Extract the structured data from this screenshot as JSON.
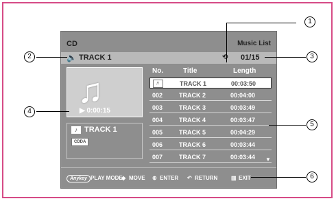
{
  "header": {
    "source": "CD",
    "view": "Music List"
  },
  "status_bar": {
    "speaker_icon": "speaker-icon",
    "track": "TRACK 1",
    "repeat_icon": "repeat-icon",
    "counter": "01/15"
  },
  "art": {
    "time": "▶ 0:00:15"
  },
  "track_panel": {
    "name": "TRACK 1",
    "format": "CDDA"
  },
  "table": {
    "headers": {
      "no": "No.",
      "title": "Title",
      "length": "Length"
    },
    "rows": [
      {
        "no": "♬",
        "title": "TRACK 1",
        "length": "00:03:50",
        "selected": true
      },
      {
        "no": "002",
        "title": "TRACK 2",
        "length": "00:04:00"
      },
      {
        "no": "003",
        "title": "TRACK 3",
        "length": "00:03:49"
      },
      {
        "no": "004",
        "title": "TRACK 4",
        "length": "00:03:47"
      },
      {
        "no": "005",
        "title": "TRACK 5",
        "length": "00:04:29"
      },
      {
        "no": "006",
        "title": "TRACK 6",
        "length": "00:03:44"
      },
      {
        "no": "007",
        "title": "TRACK 7",
        "length": "00:03:44"
      }
    ]
  },
  "footer": {
    "anykey": "Anykey",
    "play_mode": "PLAY MODE",
    "move_icon": "◆",
    "move": "MOVE",
    "enter_icon": "⊕",
    "enter": "ENTER",
    "return_icon": "↶",
    "return": "RETURN",
    "exit_icon": "▥",
    "exit": "EXIT"
  },
  "callouts": {
    "c1": "1",
    "c2": "2",
    "c3": "3",
    "c4": "4",
    "c5": "5",
    "c6": "6"
  }
}
